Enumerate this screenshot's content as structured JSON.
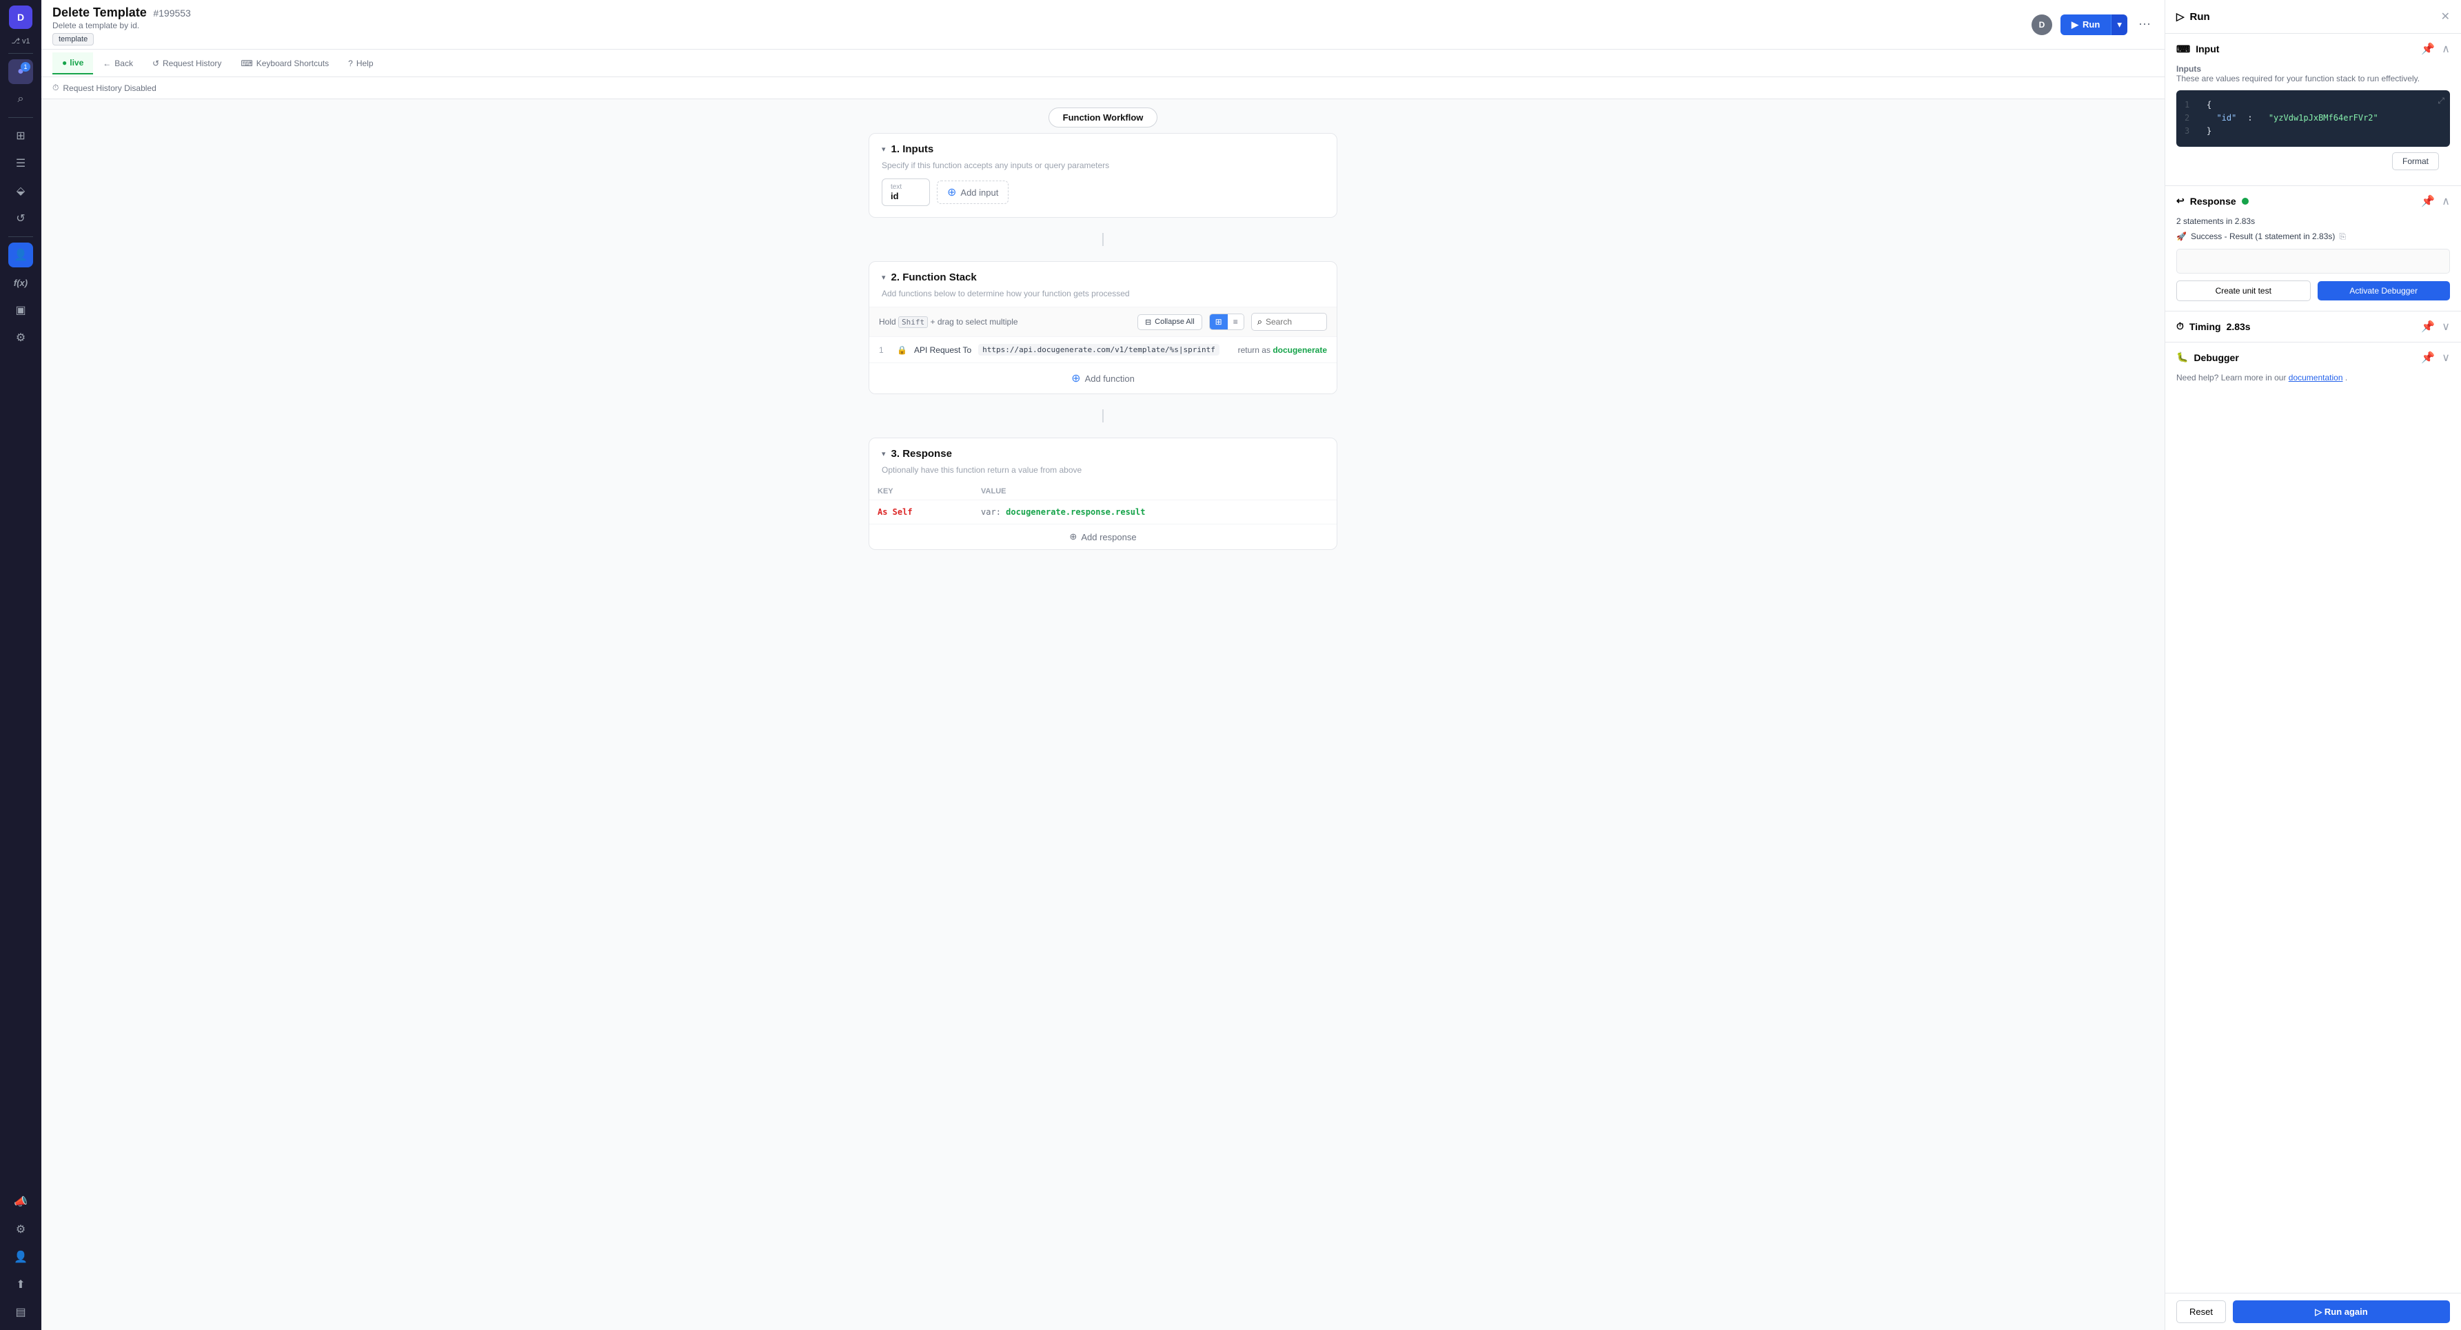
{
  "sidebar": {
    "avatar_label": "D",
    "version": "v1",
    "items": [
      {
        "id": "live",
        "label": "live",
        "icon": "●",
        "active": true,
        "badge": "1"
      },
      {
        "id": "search",
        "label": "search",
        "icon": "⌕"
      },
      {
        "id": "grid",
        "label": "grid",
        "icon": "⊞"
      },
      {
        "id": "table",
        "label": "table",
        "icon": "☰"
      },
      {
        "id": "layers",
        "label": "layers",
        "icon": "⬙"
      },
      {
        "id": "history",
        "label": "history",
        "icon": "↺"
      },
      {
        "id": "users",
        "label": "users",
        "icon": "👤",
        "active_blue": true
      },
      {
        "id": "function",
        "label": "function",
        "icon": "ƒ"
      },
      {
        "id": "package",
        "label": "package",
        "icon": "📦"
      },
      {
        "id": "settings",
        "label": "settings",
        "icon": "⚙"
      },
      {
        "id": "megaphone",
        "label": "megaphone",
        "icon": "📣"
      },
      {
        "id": "gear2",
        "label": "gear2",
        "icon": "✦"
      },
      {
        "id": "person",
        "label": "person",
        "icon": "👤"
      },
      {
        "id": "upload",
        "label": "upload",
        "icon": "⬆"
      },
      {
        "id": "sidebar",
        "label": "sidebar",
        "icon": "▤"
      }
    ]
  },
  "topbar": {
    "title": "Delete Template",
    "id": "#199553",
    "subtitle": "Delete a template by id.",
    "tag": "template",
    "avatar": "D",
    "run_label": "Run",
    "more_icon": "⋯"
  },
  "navbar": {
    "live_label": "live",
    "items": [
      {
        "label": "Back",
        "icon": "←"
      },
      {
        "label": "Request History",
        "icon": "↺"
      },
      {
        "label": "Keyboard Shortcuts",
        "icon": "⌨"
      },
      {
        "label": "Help",
        "icon": "?"
      }
    ]
  },
  "workflow": {
    "request_history_label": "Request History Disabled",
    "title": "Function Workflow",
    "sections": {
      "inputs": {
        "number": "1.",
        "title": "Inputs",
        "subtitle": "Specify if this function accepts any inputs or query parameters",
        "input_label": "text",
        "input_value": "id",
        "add_label": "Add input"
      },
      "function_stack": {
        "number": "2.",
        "title": "Function Stack",
        "subtitle": "Add functions below to determine how your function gets processed",
        "hint_hold": "Hold",
        "hint_shift": "Shift",
        "hint_rest": "+ drag to select multiple",
        "collapse_all": "Collapse All",
        "view_grid_icon": "⊞",
        "view_list_icon": "≡",
        "search_placeholder": "Search",
        "api_row": {
          "num": "1",
          "icon": "🔒",
          "label": "API Request To",
          "url": "https://api.docugenerate.com/v1/template/%s|sprintf",
          "return_label": "return as",
          "return_value": "docugenerate"
        },
        "add_function_label": "Add function"
      },
      "response": {
        "number": "3.",
        "title": "Response",
        "subtitle": "Optionally have this function return a value from above",
        "col_key": "KEY",
        "col_value": "VALUE",
        "key_cell": "As Self",
        "val_prefix": "var:",
        "val_value": "docugenerate.response.result",
        "add_response_label": "Add response"
      }
    }
  },
  "run_panel": {
    "title": "Run",
    "close_icon": "✕",
    "input_section": {
      "title": "Input",
      "pin_icon": "📌",
      "collapse_icon": "^",
      "inputs_title": "Inputs",
      "inputs_description": "These are values required for your function stack to run effectively.",
      "code_lines": [
        {
          "num": "1",
          "content": "{",
          "type": "brace"
        },
        {
          "num": "2",
          "content": "\"id\": \"yzVdw1pJxBMf64erFVr2\"",
          "type": "kv"
        },
        {
          "num": "3",
          "content": "}",
          "type": "brace"
        }
      ],
      "format_label": "Format"
    },
    "response_section": {
      "title": "Response",
      "success_indicator": true,
      "pin_icon": "📌",
      "collapse_icon": "^",
      "stats": "2 statements in 2.83s",
      "success_msg": "Success - Result (1 statement in 2.83s)",
      "result_value": "",
      "create_test_label": "Create unit test",
      "activate_debugger_label": "Activate Debugger"
    },
    "timing_section": {
      "title": "Timing",
      "icon": "⏱",
      "value": "2.83s",
      "expand_icon": "v"
    },
    "debugger_section": {
      "title": "Debugger",
      "icon": "🐛",
      "expand_icon": "v",
      "help_text": "Need help? Learn more in our ",
      "documentation_label": "documentation",
      "period": "."
    },
    "footer": {
      "reset_label": "Reset",
      "run_again_label": "▷  Run again"
    }
  }
}
